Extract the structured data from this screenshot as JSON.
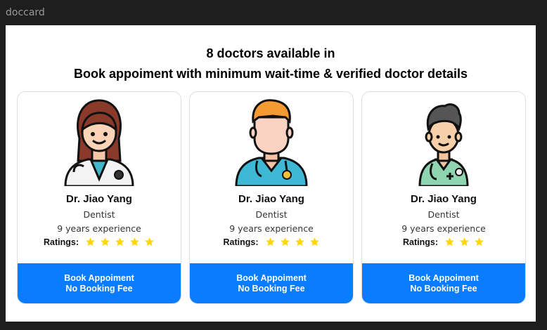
{
  "window": {
    "title": "doccard"
  },
  "header": {
    "line1": "8 doctors available in",
    "line2": "Book appoiment with minimum wait-time & verified doctor details"
  },
  "colors": {
    "accent": "#0a7cff",
    "star": "#ffd60a"
  },
  "ratings_label": "Ratings:",
  "doctors": [
    {
      "avatar_icon": "female-doctor-icon",
      "name": "Dr. Jiao Yang",
      "specialty": "Dentist",
      "experience": "9 years experience",
      "rating": 5,
      "book_label": "Book Appoiment",
      "fee_label": "No Booking Fee"
    },
    {
      "avatar_icon": "male-nurse-icon",
      "name": "Dr. Jiao Yang",
      "specialty": "Dentist",
      "experience": "9 years experience",
      "rating": 4,
      "book_label": "Book Appoiment",
      "fee_label": "No Booking Fee"
    },
    {
      "avatar_icon": "male-doctor-icon",
      "name": "Dr. Jiao Yang",
      "specialty": "Dentist",
      "experience": "9 years experience",
      "rating": 3,
      "book_label": "Book Appoiment",
      "fee_label": "No Booking Fee"
    }
  ]
}
